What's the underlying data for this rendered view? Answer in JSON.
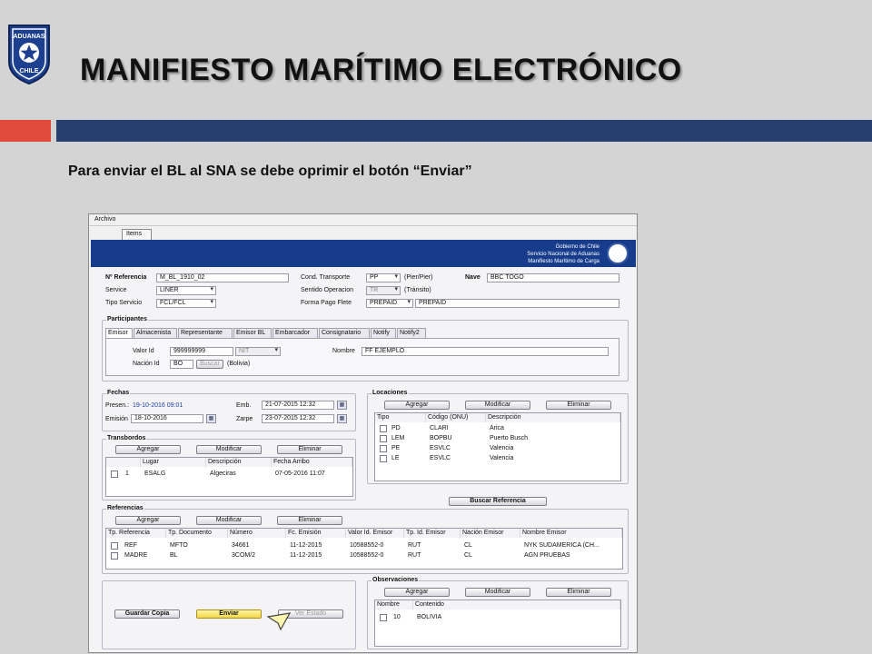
{
  "slide": {
    "title": "MANIFIESTO MARÍTIMO ELECTRÓNICO",
    "instruction": "Para enviar el BL al SNA se debe oprimir el botón “Enviar”",
    "accent_red": "#e04a3a",
    "accent_blue": "#25406e",
    "logo": {
      "top_text": "ADUANAS",
      "bottom_text": "CHILE"
    }
  },
  "app": {
    "menu": [
      "Archivo"
    ],
    "tabs": [
      "Items"
    ],
    "banner": {
      "lines": [
        "Gobierno de Chile",
        "Servicio Nacional de Aduanas",
        "Manifiesto Marítimo de Carga"
      ],
      "color": "#173c8c"
    },
    "header_form": {
      "referencia_label": "Nº Referencia",
      "referencia_value": "M_BL_1910_02",
      "service_label": "Service",
      "service_value": "LINER",
      "tipo_servicio_label": "Tipo Servicio",
      "tipo_servicio_value": "FCL/FCL",
      "cond_transporte_label": "Cond. Transporte",
      "cond_transporte_value": "PP",
      "cond_transporte_desc": "(Pier/Pier)",
      "sentido_label": "Sentido Operacion",
      "sentido_value": "TR",
      "sentido_desc": "(Tránsito)",
      "forma_pago_label": "Forma Pago Flete",
      "forma_pago_value": "PREPAID",
      "forma_pago_desc": "PREPAID",
      "nave_label": "Nave",
      "nave_value": "BBC TOGO"
    },
    "participantes": {
      "title": "Participantes",
      "tabs": [
        "Emisor",
        "Almacenista",
        "Representante",
        "Emisor BL",
        "Embarcador",
        "Consignatario",
        "Notify",
        "Notify2"
      ],
      "valor_id_label": "Valor Id",
      "valor_id_value": "999999999",
      "valor_id_type": "NIT",
      "nacion_id_label": "Nación Id",
      "nacion_id_value": "BO",
      "buscar_label": "Buscar",
      "nacion_desc": "(Bolivia)",
      "nombre_label": "Nombre",
      "nombre_value": "FF EJEMPLO"
    },
    "fechas": {
      "title": "Fechas",
      "presen_label": "Presen.:",
      "presen_value": "19-10-2016 09:01",
      "emision_label": "Emisión",
      "emision_value": "18-10-2016",
      "emb_label": "Emb.",
      "emb_value": "21-07-2015 12:32",
      "zarpe_label": "Zarpe",
      "zarpe_value": "23-07-2015 12:32"
    },
    "locaciones": {
      "title": "Locaciones",
      "buttons": {
        "add": "Agregar",
        "edit": "Modificar",
        "delete": "Eliminar"
      },
      "columns": [
        "Tipo",
        "Código (ONU)",
        "Descripción"
      ],
      "rows": [
        [
          "PD",
          "CLARI",
          "Arica"
        ],
        [
          "LEM",
          "BOPBU",
          "Puerto Busch"
        ],
        [
          "PE",
          "ESVLC",
          "Valencia"
        ],
        [
          "LE",
          "ESVLC",
          "Valencia"
        ]
      ],
      "buscar_referencia": "Buscar Referencia"
    },
    "transbordos": {
      "title": "Transbordos",
      "buttons": {
        "add": "Agregar",
        "edit": "Modificar",
        "delete": "Eliminar"
      },
      "columns": [
        "Lugar",
        "Descripción",
        "Fecha Arribo"
      ],
      "rows": [
        [
          "1",
          "ESALG",
          "Algeciras",
          "07-05-2016 11:07"
        ]
      ]
    },
    "referencias": {
      "title": "Referencias",
      "buttons": {
        "add": "Agregar",
        "edit": "Modificar",
        "delete": "Eliminar"
      },
      "columns": [
        "Tp. Referencia",
        "Tp. Documento",
        "Número",
        "Fc. Emisión",
        "Valor Id. Emisor",
        "Tp. Id. Emisor",
        "Nación Emisor",
        "Nombre Emisor"
      ],
      "rows": [
        [
          "REF",
          "MFTO",
          "34661",
          "11-12-2015",
          "10588552-0",
          "RUT",
          "CL",
          "NYK SUDAMERICA (CH..."
        ],
        [
          "MADRE",
          "BL",
          "3COM/2",
          "11-12-2015",
          "10588552-0",
          "RUT",
          "CL",
          "AGN PRUEBAS"
        ]
      ]
    },
    "observaciones": {
      "title": "Observaciones",
      "buttons": {
        "add": "Agregar",
        "edit": "Modificar",
        "delete": "Eliminar"
      },
      "columns": [
        "Nombre",
        "Contenido"
      ],
      "rows": [
        [
          "10",
          "BOLIVIA"
        ]
      ]
    },
    "actions": {
      "guardar": "Guardar Copia",
      "enviar": "Enviar",
      "ver_estado": "Ver Estado"
    }
  }
}
